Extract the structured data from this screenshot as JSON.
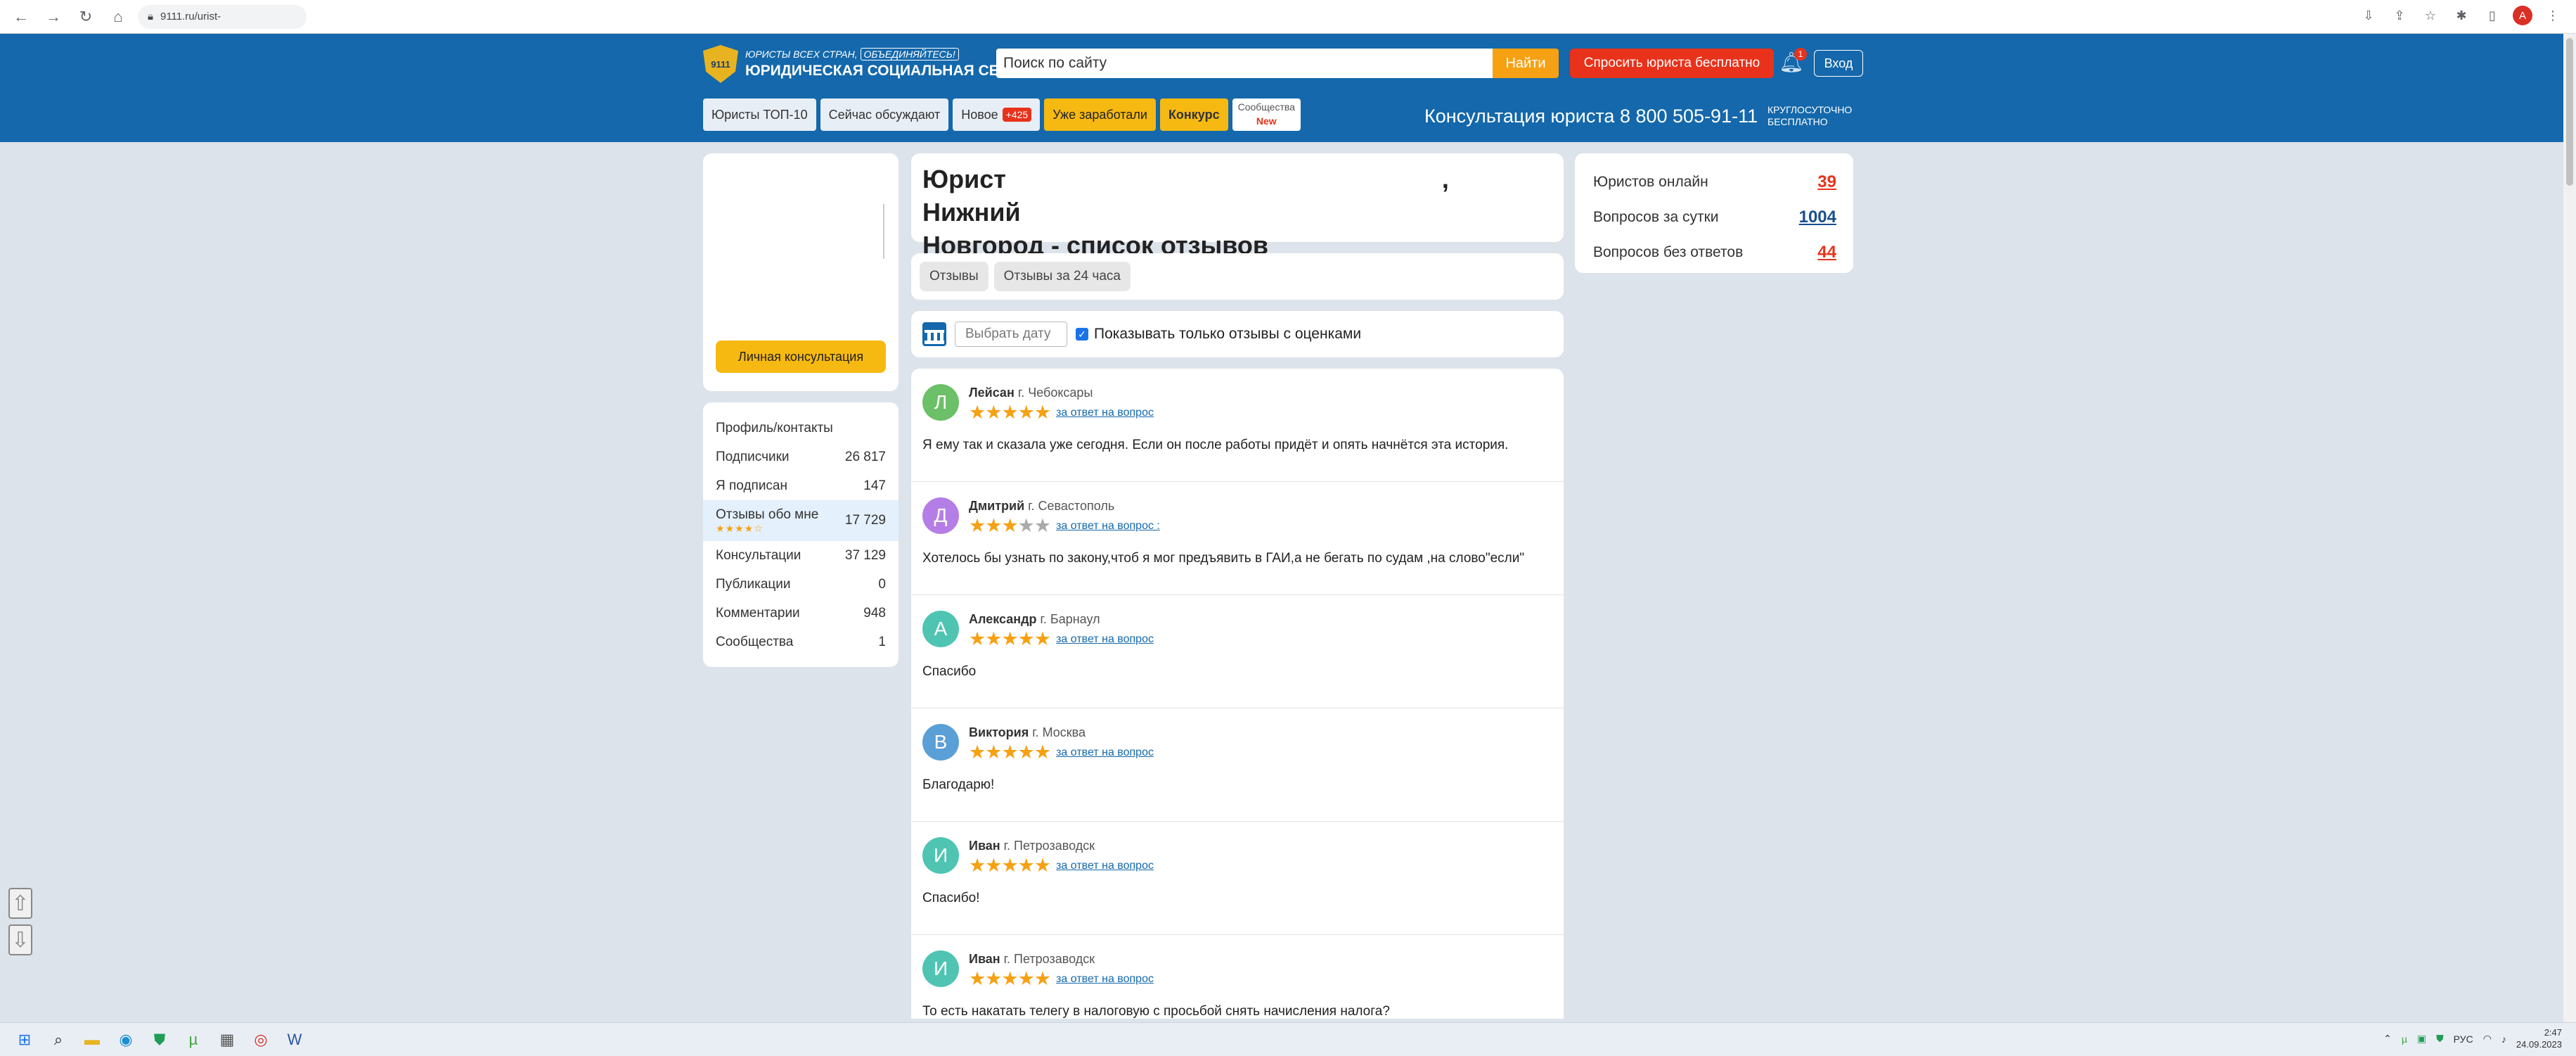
{
  "browser": {
    "url": "9111.ru/urist-"
  },
  "header": {
    "logo_badge": "9111",
    "logo_top_a": "ЮРИСТЫ ВСЕХ СТРАН,",
    "logo_top_b": "ОБЪЕДИНЯЙТЕСЬ!",
    "logo_main": "ЮРИДИЧЕСКАЯ СОЦИАЛЬНАЯ СЕТЬ",
    "search_placeholder": "Поиск по сайту",
    "search_button": "Найти",
    "ask_button": "Спросить юриста бесплатно",
    "notifications_count": "1",
    "login_button": "Вход",
    "phone_text": "Консультация юриста 8 800 505-91-11",
    "phone_sub_1": "КРУГЛОСУТОЧНО",
    "phone_sub_2": "БЕСПЛАТНО"
  },
  "nav": {
    "top10": "Юристы ТОП-10",
    "discuss": "Сейчас обсуждают",
    "new": "Новое",
    "new_count": "+425",
    "earned": "Уже заработали",
    "contest": "Конкурс",
    "communities": "Сообщества",
    "communities_new": "New"
  },
  "profile": {
    "consult_button": "Личная консультация"
  },
  "menu": {
    "items": [
      {
        "label": "Профиль/контакты",
        "value": ""
      },
      {
        "label": "Подписчики",
        "value": "26 817"
      },
      {
        "label": "Я подписан",
        "value": "147"
      },
      {
        "label": "Отзывы обо мне",
        "value": "17 729",
        "stars": "★★★★☆"
      },
      {
        "label": "Консультации",
        "value": "37 129"
      },
      {
        "label": "Публикации",
        "value": "0"
      },
      {
        "label": "Комментарии",
        "value": "948"
      },
      {
        "label": "Сообщества",
        "value": "1"
      }
    ]
  },
  "title": {
    "line1_a": "Юрист",
    "line1_b": ", Нижний",
    "line2": "Новгород - список отзывов"
  },
  "review_tabs": {
    "all": "Отзывы",
    "day": "Отзывы за 24 часа"
  },
  "filter": {
    "date_placeholder": "Выбрать дату",
    "only_rated_label": "Показывать только отзывы с оценками",
    "only_rated_checked": true
  },
  "reviews": [
    {
      "initial": "Л",
      "color": "#6cc068",
      "name": "Лейсан",
      "city": "г. Чебоксары",
      "rating": 5,
      "link": "за ответ на вопрос",
      "text": "Я ему так и сказала уже сегодня. Если он после работы придёт и опять начнётся эта история."
    },
    {
      "initial": "Д",
      "color": "#b57ee6",
      "name": "Дмитрий",
      "city": "г. Севастополь",
      "rating": 3,
      "link": "за ответ на вопрос :",
      "text": "Хотелось бы узнать по закону,чтоб я мог предъявить в ГАИ,а не бегать по судам ,на слово\"если\""
    },
    {
      "initial": "А",
      "color": "#4fc4b3",
      "name": "Александр",
      "city": "г. Барнаул",
      "rating": 5,
      "link": "за ответ на вопрос",
      "text": "Спасибо"
    },
    {
      "initial": "В",
      "color": "#5a9fd6",
      "name": "Виктория",
      "city": "г. Москва",
      "rating": 5,
      "link": "за ответ на вопрос",
      "text": "Благодарю!"
    },
    {
      "initial": "И",
      "color": "#4fc4b3",
      "name": "Иван",
      "city": "г. Петрозаводск",
      "rating": 5,
      "link": "за ответ на вопрос",
      "text": "Спасибо!"
    },
    {
      "initial": "И",
      "color": "#4fc4b3",
      "name": "Иван",
      "city": "г. Петрозаводск",
      "rating": 5,
      "link": "за ответ на вопрос",
      "text": "То есть накатать телегу в налоговую с просьбой снять начисления налога?"
    }
  ],
  "stats": {
    "online_label": "Юристов онлайн",
    "online_value": "39",
    "day_label": "Вопросов за сутки",
    "day_value": "1004",
    "unanswered_label": "Вопросов без ответов",
    "unanswered_value": "44"
  },
  "taskbar": {
    "lang": "РУС",
    "time": "2:47",
    "date": "24.09.2023"
  },
  "colors": {
    "brand_blue": "#1468ab",
    "accent_orange": "#f6a113",
    "accent_red": "#e8321b",
    "accent_yellow": "#f6b912"
  }
}
